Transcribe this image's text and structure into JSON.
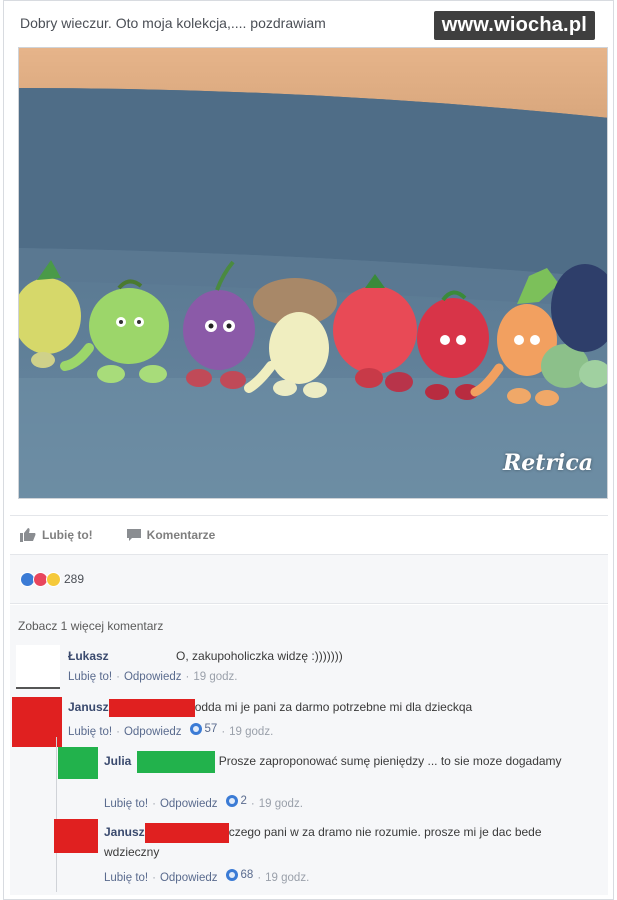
{
  "post": {
    "text": "Dobry wieczur. Oto moja kolekcja,.... pozdrawiam",
    "watermark": "www.wiocha.pl",
    "photo_caption": "Retrica"
  },
  "actions": {
    "like_label": "Lubię to!",
    "comment_label": "Komentarze"
  },
  "reactions": {
    "count": "289",
    "icons": [
      "like-icon",
      "love-icon",
      "wow-icon"
    ],
    "colors": {
      "like": "#3b7bd5",
      "love": "#e8465d",
      "wow": "#f5c93a"
    }
  },
  "comments_section": {
    "see_more": "Zobacz 1 więcej komentarz",
    "comments": [
      {
        "author": "Łukasz",
        "text": "O, zakupoholiczka widzę :)))))))",
        "like": "Lubię to!",
        "reply": "Odpowiedz",
        "likes": "",
        "time": "19 godz.",
        "redaction_color": ""
      },
      {
        "author": "Janusz",
        "text": "odda mi je pani za darmo potrzebne mi dla dzieckqa",
        "like": "Lubię to!",
        "reply": "Odpowiedz",
        "likes": "57",
        "time": "19 godz.",
        "redaction_color": "#e02020"
      },
      {
        "author": "Julia",
        "text": "Prosze zaproponować sumę pieniędzy ... to sie moze dogadamy",
        "like": "Lubię to!",
        "reply": "Odpowiedz",
        "likes": "2",
        "time": "19 godz.",
        "redaction_color": "#22b24c"
      },
      {
        "author": "Janusz",
        "text": "czego pani w za dramo nie rozumie. prosze mi je dac bede wdzieczny",
        "like": "Lubię to!",
        "reply": "Odpowiedz",
        "likes": "68",
        "time": "19 godz.",
        "redaction_color": "#e02020"
      }
    ]
  }
}
